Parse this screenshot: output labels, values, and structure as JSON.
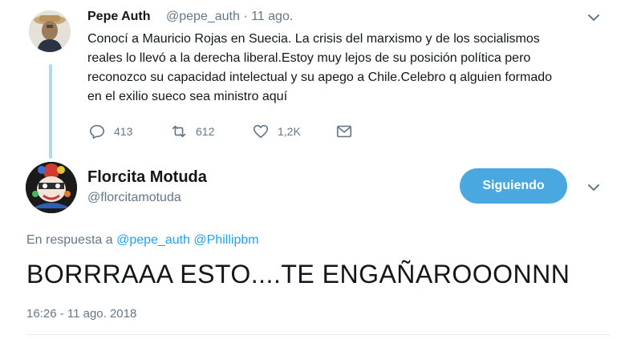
{
  "parent_tweet": {
    "name": "Pepe Auth",
    "handle_time": "@pepe_auth · 11 ago.",
    "lines": [
      "Conocí a Mauricio Rojas en Suecia. La crisis del marxismo y de los socialismos",
      "reales lo llevó a la derecha liberal.Estoy muy lejos de su posición política pero",
      "reconozco su capacidad intelectual y su apego a Chile.Celebro q alguien formado",
      "en el exilio sueco sea ministro aquí"
    ],
    "replies": "413",
    "retweets": "612",
    "likes": "1,2K"
  },
  "reply_tweet": {
    "name": "Florcita Motuda",
    "handle": "@florcitamotuda",
    "follow_label": "Siguiendo",
    "reply_prefix": "En respuesta a",
    "mention1": "@pepe_auth",
    "mention2": "@Phillipbm",
    "text": "BORRRAAA ESTO....TE ENGAÑAROOONNN",
    "timestamp": "16:26 - 11 ago. 2018"
  },
  "colors": {
    "accent": "#1da1f2",
    "follow_button": "#4aa8e0",
    "muted": "#657786",
    "thread_line": "#a9dbf5"
  }
}
